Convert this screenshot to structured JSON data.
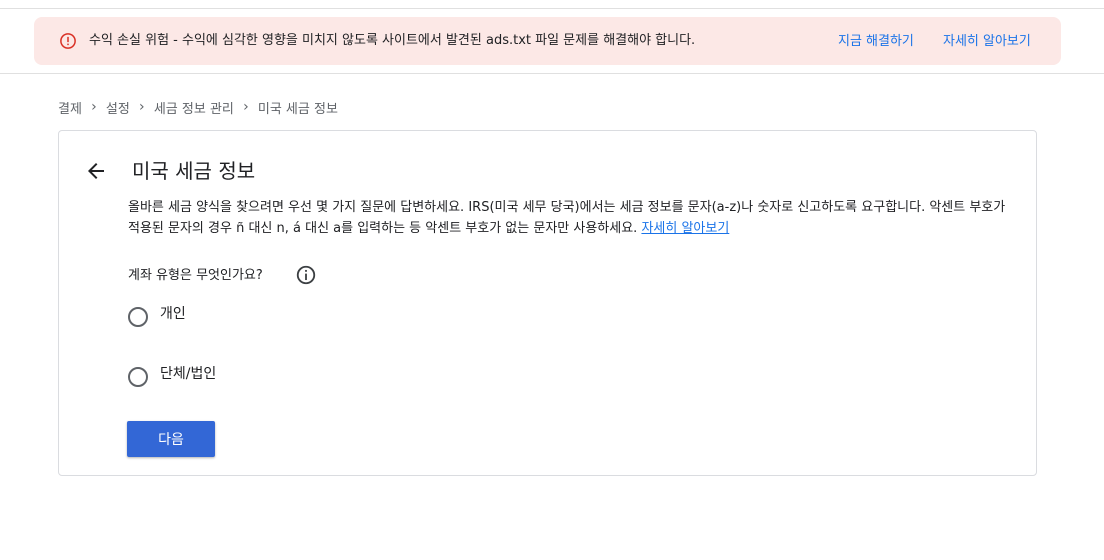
{
  "alert": {
    "icon": "error-icon",
    "color": "#d93025",
    "background": "#fce8e6",
    "message": "수익 손실 위험 - 수익에 심각한 영향을 미치지 않도록 사이트에서 발견된 ads.txt 파일 문제를 해결해야 합니다.",
    "fix_link": "지금 해결하기",
    "learn_link": "자세히 알아보기"
  },
  "breadcrumb": {
    "items": [
      "결제",
      "설정",
      "세금 정보 관리",
      "미국 세금 정보"
    ],
    "separator": "›"
  },
  "card": {
    "back_icon": "arrow-left-icon",
    "title": "미국 세금 정보",
    "description": "올바른 세금 양식을 찾으려면 우선 몇 가지 질문에 답변하세요. IRS(미국 세무 당국)에서는 세금 정보를 문자(a-z)나 숫자로 신고하도록 요구합니다. 악센트 부호가 적용된 문자의 경우 ñ 대신 n, á 대신 a를 입력하는 등 악센트 부호가 없는 문자만 사용하세요. ",
    "description_link": "자세히 알아보기",
    "question": "계좌 유형은 무엇인가요?",
    "info_icon": "info-icon",
    "options": [
      {
        "label": "개인",
        "selected": false
      },
      {
        "label": "단체/법인",
        "selected": false
      }
    ],
    "next_button": "다음",
    "accent": "#3367d6",
    "link_color": "#1a73e8"
  }
}
